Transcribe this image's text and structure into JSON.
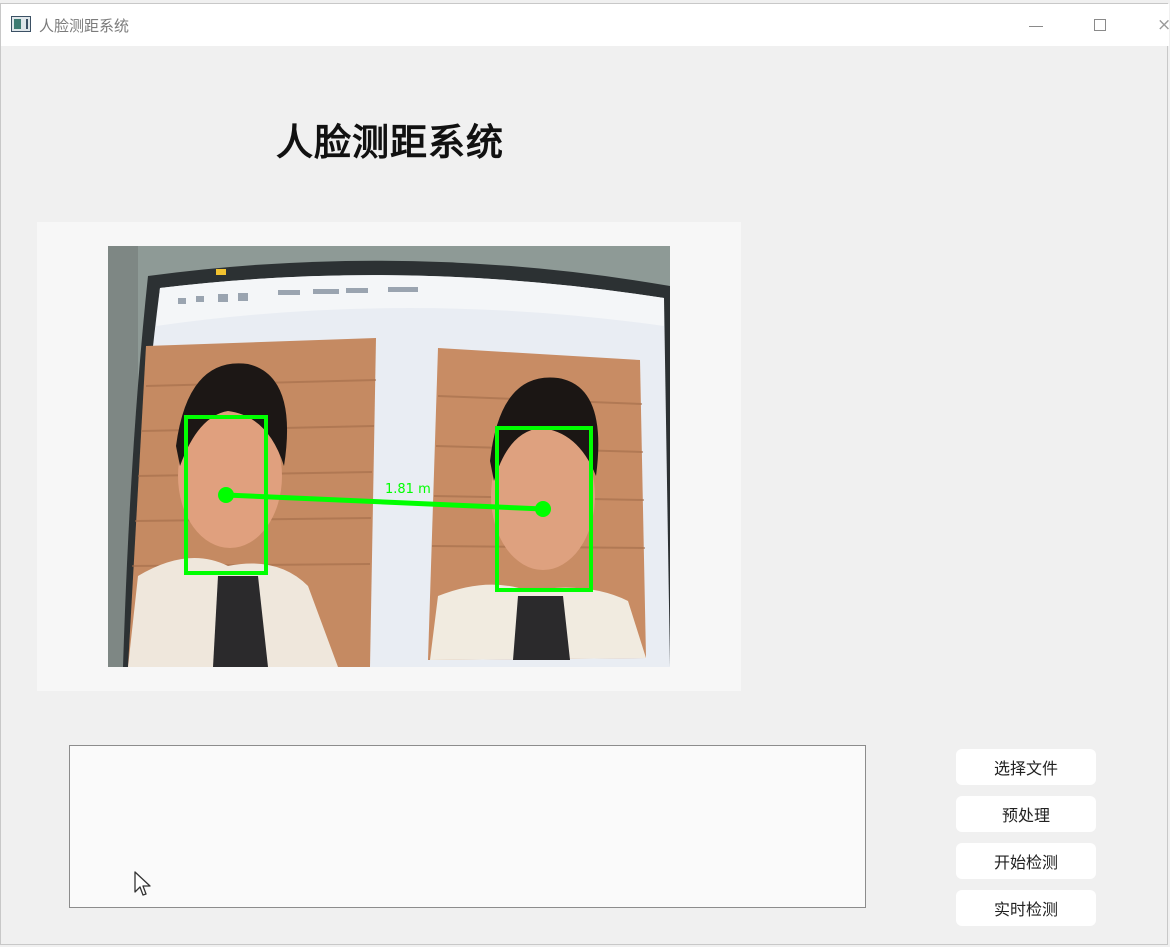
{
  "window": {
    "title": "人脸测距系统",
    "controls": [
      "minimize",
      "maximize",
      "close"
    ],
    "close_glyph": "×"
  },
  "main": {
    "heading": "人脸测距系统",
    "detection": {
      "faces_detected": 2,
      "distance_label": "1.81 m",
      "overlay_color": "#00ff00"
    }
  },
  "log": {
    "value": ""
  },
  "buttons": {
    "select_file": "选择文件",
    "preprocess": "预处理",
    "start_detect": "开始检测",
    "realtime_detect": "实时检测"
  }
}
